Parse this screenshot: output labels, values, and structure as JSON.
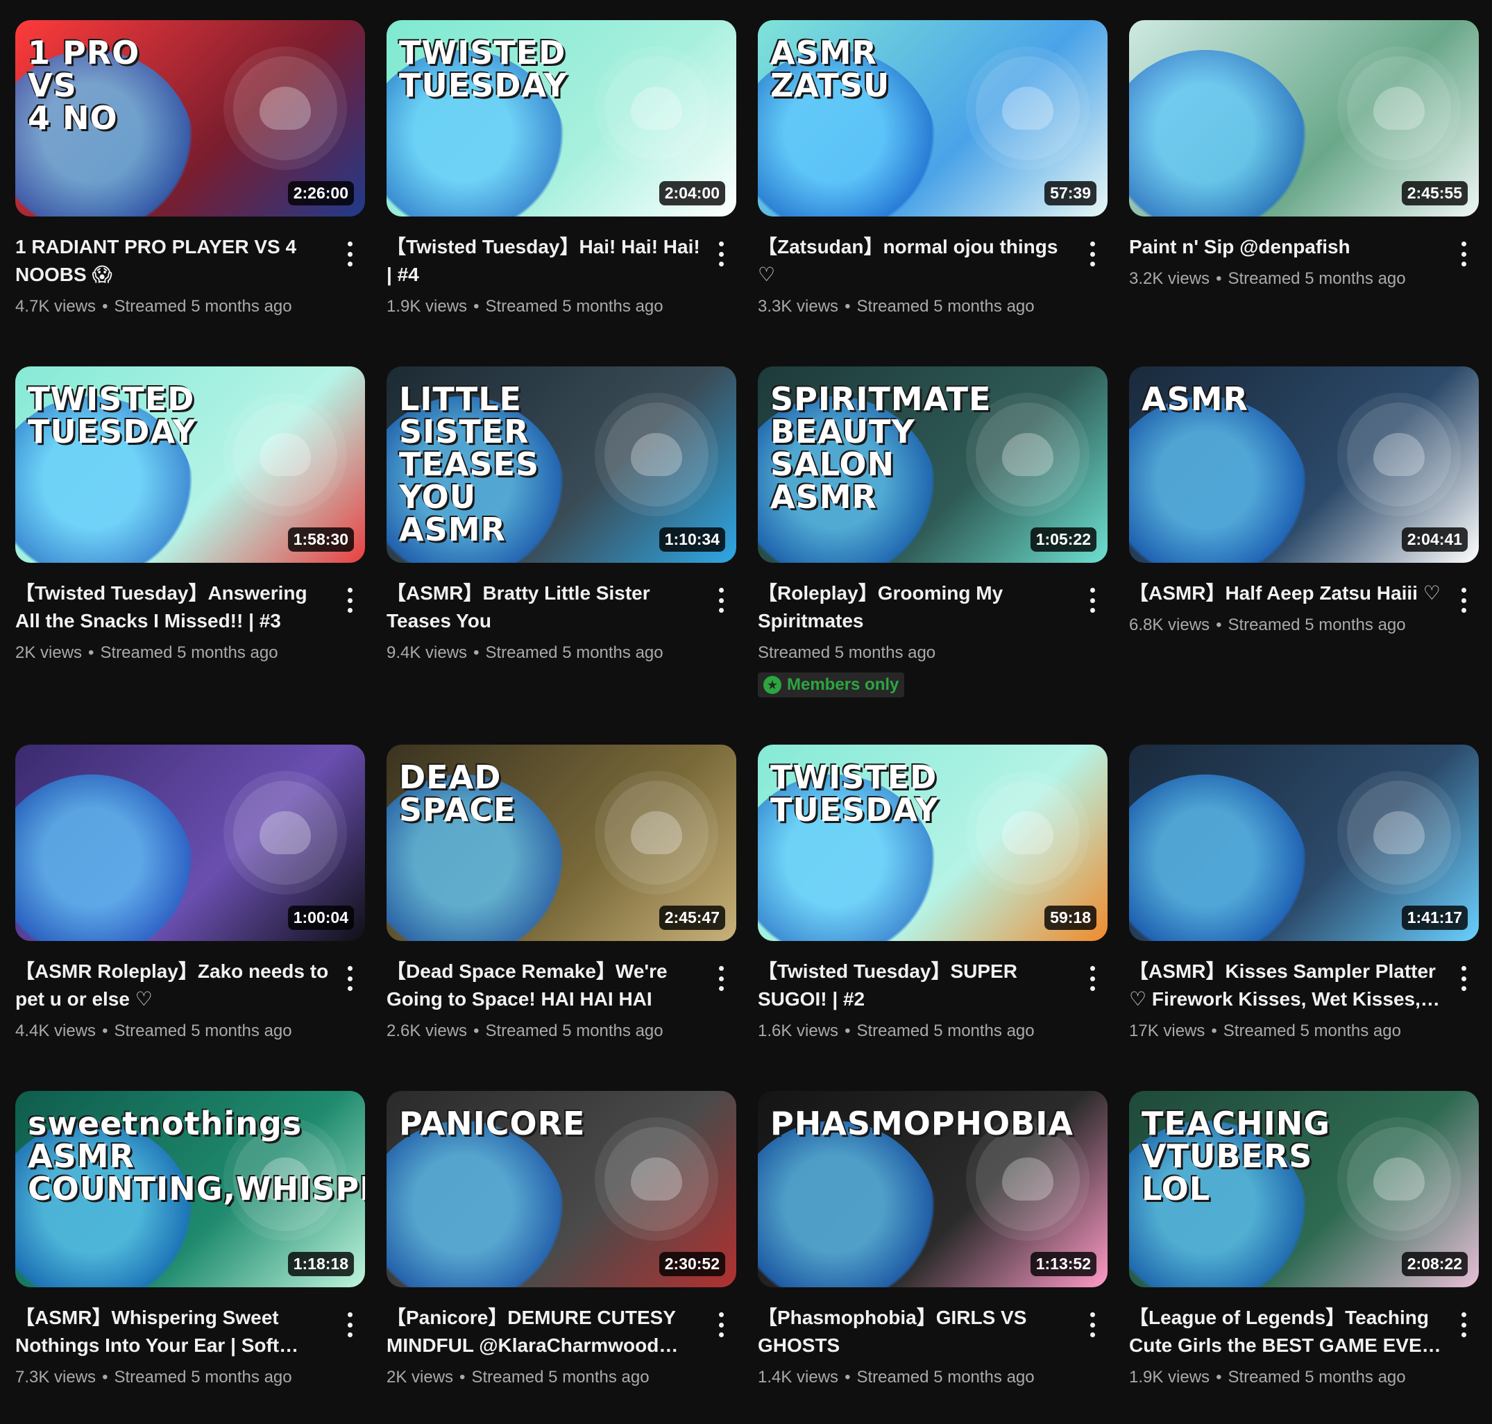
{
  "videos": [
    {
      "title": "1 RADIANT PRO PLAYER VS 4 NOOBS 😱",
      "views": "4.7K views",
      "time": "Streamed 5 months ago",
      "duration": "2:26:00",
      "thumb_text": "1 PRO\nVS\n4 NO",
      "thumb_colors": [
        "#ff3b3b",
        "#7a1d2e",
        "#203a8c"
      ]
    },
    {
      "title": "【Twisted Tuesday】Hai! Hai! Hai! | #4",
      "views": "1.9K views",
      "time": "Streamed 5 months ago",
      "duration": "2:04:00",
      "thumb_text": "TWISTED\nTUESDAY",
      "thumb_colors": [
        "#7fe9d0",
        "#a8f0de",
        "#ffffff"
      ]
    },
    {
      "title": "【Zatsudan】normal ojou things ♡",
      "views": "3.3K views",
      "time": "Streamed 5 months ago",
      "duration": "57:39",
      "thumb_text": "ASMR\nZATSU",
      "thumb_colors": [
        "#7fe3d8",
        "#4aa3e8",
        "#e8f7f5"
      ]
    },
    {
      "title": "Paint n' Sip @denpafish",
      "views": "3.2K views",
      "time": "Streamed 5 months ago",
      "duration": "2:45:55",
      "thumb_text": "",
      "thumb_colors": [
        "#cfe9e2",
        "#6aa88a",
        "#eef6f4"
      ]
    },
    {
      "title": "【Twisted Tuesday】Answering All the Snacks I Missed!! | #3",
      "views": "2K views",
      "time": "Streamed 5 months ago",
      "duration": "1:58:30",
      "thumb_text": "TWISTED\nTUESDAY",
      "thumb_colors": [
        "#86ead6",
        "#b5f3e6",
        "#e94040"
      ]
    },
    {
      "title": "【ASMR】Bratty Little Sister Teases You",
      "views": "9.4K views",
      "time": "Streamed 5 months ago",
      "duration": "1:10:34",
      "thumb_text": "LITTLE SISTER\nTEASES YOU\nASMR",
      "thumb_colors": [
        "#1c2a33",
        "#3a4c57",
        "#2ea8e6"
      ]
    },
    {
      "title": "【Roleplay】Grooming My Spiritmates",
      "views": "",
      "time": "Streamed 5 months ago",
      "duration": "1:05:22",
      "thumb_text": "SPIRITMATE\nBEAUTY SALON\nASMR",
      "thumb_colors": [
        "#1d3a3a",
        "#2f5a55",
        "#6de0d0"
      ],
      "badge": "Members only"
    },
    {
      "title": "【ASMR】Half Aeep Zatsu Haiii ♡",
      "views": "6.8K views",
      "time": "Streamed 5 months ago",
      "duration": "2:04:41",
      "thumb_text": "ASMR",
      "thumb_colors": [
        "#1a2a3c",
        "#2c4a6a",
        "#ffffff"
      ]
    },
    {
      "title": "【ASMR Roleplay】Zako needs to pet u or else ♡",
      "views": "4.4K views",
      "time": "Streamed 5 months ago",
      "duration": "1:00:04",
      "thumb_text": "",
      "thumb_colors": [
        "#3b2a6e",
        "#6a4fb0",
        "#101018"
      ]
    },
    {
      "title": "【Dead Space Remake】We're Going to Space! HAI HAI HAI",
      "views": "2.6K views",
      "time": "Streamed 5 months ago",
      "duration": "2:45:47",
      "thumb_text": "DEAD\nSPACE",
      "thumb_colors": [
        "#3a3320",
        "#7a6a3a",
        "#c9b27a"
      ]
    },
    {
      "title": "【Twisted Tuesday】SUPER SUGOI! | #2",
      "views": "1.6K views",
      "time": "Streamed 5 months ago",
      "duration": "59:18",
      "thumb_text": "TWISTED\nTUESDAY",
      "thumb_colors": [
        "#86ead6",
        "#b5f3e6",
        "#f08a2c"
      ]
    },
    {
      "title": "【ASMR】Kisses Sampler Platter ♡ Firework Kisses, Wet Kisses, Fluffy Kisses",
      "views": "17K views",
      "time": "Streamed 5 months ago",
      "duration": "1:41:17",
      "thumb_text": "",
      "thumb_colors": [
        "#1a2a3c",
        "#2c4a6a",
        "#6ad0ff"
      ]
    },
    {
      "title": "【ASMR】Whispering Sweet Nothings Into Your Ear | Soft Spoken",
      "views": "7.3K views",
      "time": "Streamed 5 months ago",
      "duration": "1:18:18",
      "thumb_text": "sweetnothings\nASMR\nCOUNTING,WHISPERS",
      "thumb_colors": [
        "#0f5d4c",
        "#1f8a6e",
        "#bff5dd"
      ]
    },
    {
      "title": "【Panicore】DEMURE CUTESY MINDFUL @KlaraCharmwood @LilyHopkins",
      "views": "2K views",
      "time": "Streamed 5 months ago",
      "duration": "2:30:52",
      "thumb_text": "PANICORE",
      "thumb_colors": [
        "#2a2a2a",
        "#4a4a4a",
        "#b33030"
      ]
    },
    {
      "title": "【Phasmophobia】GIRLS VS GHOSTS",
      "views": "1.4K views",
      "time": "Streamed 5 months ago",
      "duration": "1:13:52",
      "thumb_text": "PHASMOPHOBIA",
      "thumb_colors": [
        "#141414",
        "#2b2b2b",
        "#ff9ac8"
      ]
    },
    {
      "title": "【League of Legends】Teaching Cute Girls the BEST GAME EVER MADE",
      "views": "1.9K views",
      "time": "Streamed 5 months ago",
      "duration": "2:08:22",
      "thumb_text": "TEACHING VTUBERS LOL",
      "thumb_colors": [
        "#1f4a3a",
        "#2e6a52",
        "#e8c0d8"
      ]
    }
  ]
}
